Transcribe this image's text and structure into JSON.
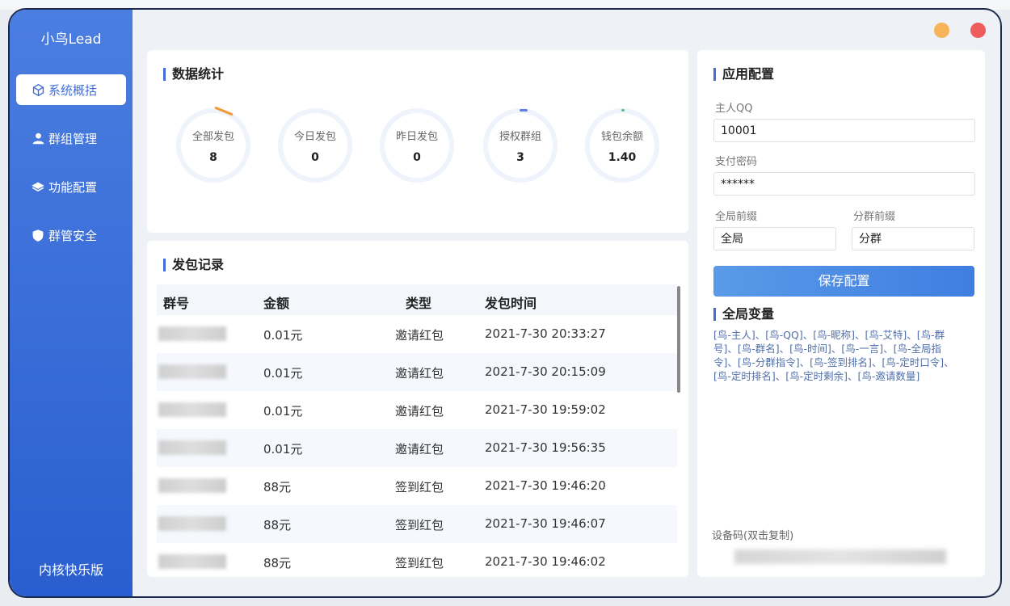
{
  "app": {
    "title": "小鸟Lead",
    "edition": "内核快乐版"
  },
  "sidebar": {
    "items": [
      {
        "label": "系统概括",
        "icon": "cube-icon",
        "active": true
      },
      {
        "label": "群组管理",
        "icon": "user-icon",
        "active": false
      },
      {
        "label": "功能配置",
        "icon": "layers-icon",
        "active": false
      },
      {
        "label": "群管安全",
        "icon": "shield-icon",
        "active": false
      }
    ]
  },
  "stats": {
    "title": "数据统计",
    "items": [
      {
        "label": "全部发包",
        "value": "8"
      },
      {
        "label": "今日发包",
        "value": "0"
      },
      {
        "label": "昨日发包",
        "value": "0"
      },
      {
        "label": "授权群组",
        "value": "3"
      },
      {
        "label": "钱包余额",
        "value": "1.40"
      }
    ]
  },
  "records": {
    "title": "发包记录",
    "columns": [
      "群号",
      "金额",
      "类型",
      "发包时间"
    ],
    "rows": [
      {
        "amount": "0.01元",
        "type": "邀请红包",
        "time": "2021-7-30 20:33:27"
      },
      {
        "amount": "0.01元",
        "type": "邀请红包",
        "time": "2021-7-30 20:15:09"
      },
      {
        "amount": "0.01元",
        "type": "邀请红包",
        "time": "2021-7-30 19:59:02"
      },
      {
        "amount": "0.01元",
        "type": "邀请红包",
        "time": "2021-7-30 19:56:35"
      },
      {
        "amount": "88元",
        "type": "签到红包",
        "time": "2021-7-30 19:46:20"
      },
      {
        "amount": "88元",
        "type": "签到红包",
        "time": "2021-7-30 19:46:07"
      },
      {
        "amount": "88元",
        "type": "签到红包",
        "time": "2021-7-30 19:46:02"
      }
    ]
  },
  "config": {
    "title": "应用配置",
    "owner_qq_label": "主人QQ",
    "owner_qq_value": "10001",
    "pay_password_label": "支付密码",
    "pay_password_value": "******",
    "global_prefix_label": "全局前缀",
    "global_prefix_value": "全局",
    "group_prefix_label": "分群前缀",
    "group_prefix_value": "分群",
    "save_label": "保存配置",
    "vars_title": "全局变量",
    "vars_text": "[鸟-主人]、[鸟-QQ]、[鸟-昵称]、[鸟-艾特]、[鸟-群号]、[鸟-群名]、[鸟-时间]、[鸟-一言]、[鸟-全局指令]、[鸟-分群指令]、[鸟-签到排名]、[鸟-定时口令]、[鸟-定时排名]、[鸟-定时剩余]、[鸟-邀请数量]",
    "device_label": "设备码(双击复制)"
  },
  "colors": {
    "accent": "#3f6ed8",
    "minimize": "#f7b35a",
    "close": "#ee5c5c"
  }
}
